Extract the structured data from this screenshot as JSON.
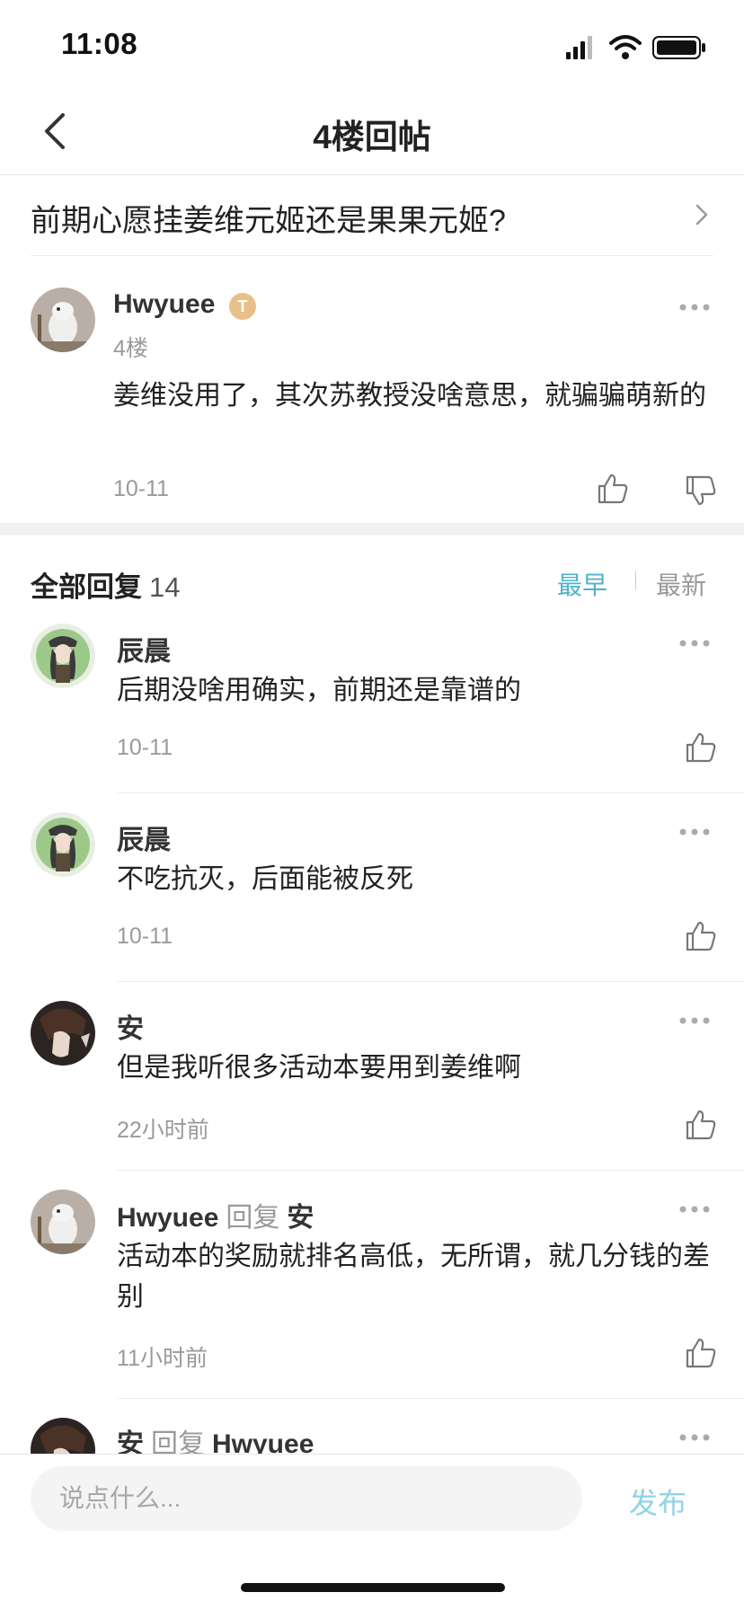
{
  "status_bar": {
    "time": "11:08",
    "icons": [
      "signal-icon",
      "wifi-icon",
      "battery-icon"
    ]
  },
  "nav": {
    "title": "4楼回帖",
    "back_icon": "chevron-left-icon"
  },
  "thread": {
    "title": "前期心愿挂姜维元姬还是果果元姬?"
  },
  "main_post": {
    "username": "Hwyuee",
    "badge": "T",
    "floor": "4楼",
    "content": "姜维没用了，其次苏教授没啥意思，就骗骗萌新的",
    "date": "10-11"
  },
  "replies_header": {
    "title": "全部回复",
    "count": "14",
    "sort_earliest": "最早",
    "sort_newest": "最新"
  },
  "replies": [
    {
      "username": "辰晨",
      "content": "后期没啥用确实，前期还是靠谱的",
      "date": "10-11"
    },
    {
      "username": "辰晨",
      "content": "不吃抗灭，后面能被反死",
      "date": "10-11"
    },
    {
      "username": "安",
      "content": "但是我听很多活动本要用到姜维啊",
      "date": "22小时前"
    },
    {
      "username": "Hwyuee",
      "reply_word": "回复",
      "reply_to": "安",
      "content": "活动本的奖励就排名高低，无所谓，就几分钱的差别",
      "date": "11小时前"
    },
    {
      "username": "安",
      "reply_word": "回复",
      "reply_to": "Hwyuee"
    }
  ],
  "composer": {
    "placeholder": "说点什么...",
    "publish_label": "发布"
  },
  "colors": {
    "accent": "#4fb3c8",
    "publish": "#8fd3e6",
    "muted": "#9a9a9a"
  }
}
